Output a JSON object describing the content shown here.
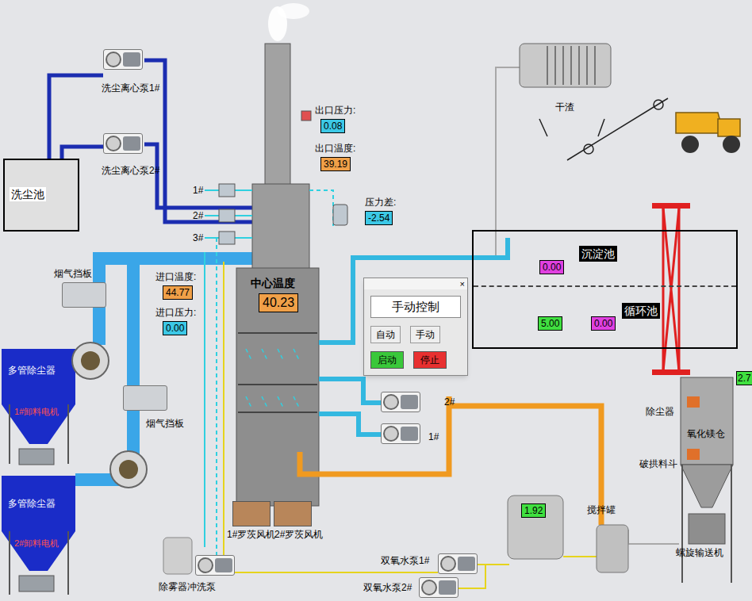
{
  "wash_pool": "洗尘池",
  "wash_pumps": [
    "洗尘离心泵1#",
    "洗尘离心泵2#"
  ],
  "spray_levels": [
    "1#",
    "2#",
    "3#"
  ],
  "outlet_pressure": {
    "label": "出口压力:",
    "value": "0.08",
    "color": "#3cc8e6"
  },
  "outlet_temperature": {
    "label": "出口温度:",
    "value": "39.19",
    "color": "#f0a048"
  },
  "pressure_diff": {
    "label": "压力差:",
    "value": "-2.54",
    "color": "#3cc8e6"
  },
  "inlet_temperature": {
    "label": "进口温度:",
    "value": "44.77",
    "color": "#f0a048"
  },
  "inlet_pressure": {
    "label": "进口压力:",
    "value": "0.00",
    "color": "#3cc8e6"
  },
  "center_temperature": {
    "label": "中心温度",
    "value": "40.23",
    "color": "#f0a048"
  },
  "flue_dampers": [
    "烟气挡板",
    "烟气挡板"
  ],
  "dust_collectors": [
    {
      "label": "多管除尘器",
      "motor": "1#卸料电机"
    },
    {
      "label": "多管除尘器",
      "motor": "2#卸料电机"
    }
  ],
  "dry_slag": "干渣",
  "pools": [
    "沉淀池",
    "循环池"
  ],
  "pool_readings": [
    {
      "value": "0.00",
      "color": "#e040e0"
    },
    {
      "value": "5.00",
      "color": "#40e040"
    },
    {
      "value": "0.00",
      "color": "#e040e0"
    }
  ],
  "dialog": {
    "close": "×",
    "heading": "手动控制",
    "mode_buttons": [
      "自动",
      "手动"
    ],
    "start": "启动",
    "stop": "停止"
  },
  "circ_pumps": [
    "2#",
    "1#"
  ],
  "roots_blowers": [
    "1#罗茨风机",
    "2#罗茨风机"
  ],
  "mist_pump": "除雾器冲洗泵",
  "peroxide_pumps": [
    "双氧水泵1#",
    "双氧水泵2#"
  ],
  "peroxide_tank": {
    "value": "1.92",
    "color": "#40e040"
  },
  "mixing_tank": "搅拌罐",
  "silo": {
    "dust_remover": "除尘器",
    "label": "氧化镁仓",
    "hopper": "破拱料斗",
    "conveyor": "螺旋输送机",
    "value": "2.7",
    "color": "#40e040"
  }
}
